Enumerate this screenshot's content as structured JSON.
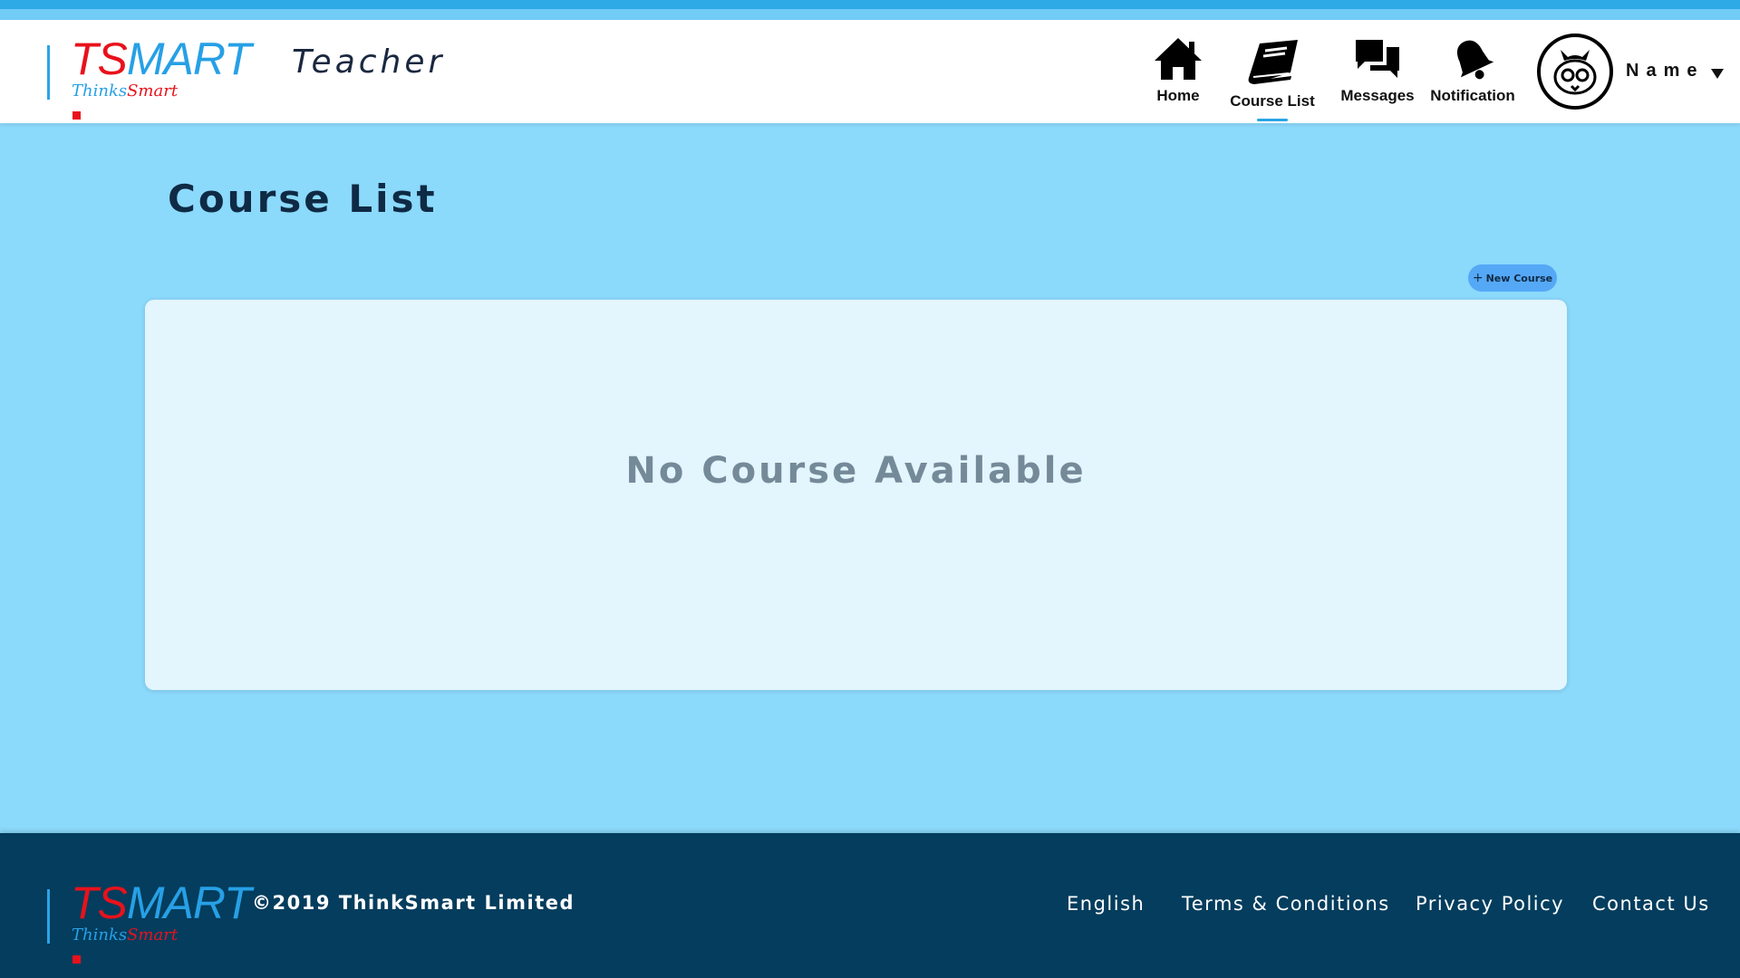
{
  "brand": {
    "wordmark_ts": "TS",
    "wordmark_mart": "MART",
    "tagline_thinks": "Thinks",
    "tagline_smart": "Smart",
    "colors": {
      "red": "#e8121c",
      "blue": "#27a0e6"
    }
  },
  "header": {
    "role": "Teacher",
    "nav": [
      {
        "label": "Home",
        "icon": "home-icon"
      },
      {
        "label": "Course List",
        "icon": "book-icon",
        "active": true
      },
      {
        "label": "Messages",
        "icon": "chat-icon"
      },
      {
        "label": "Notification",
        "icon": "bell-icon"
      }
    ],
    "user": {
      "name": "Name",
      "avatar_icon": "owl-avatar-icon"
    }
  },
  "main": {
    "title": "Course List",
    "new_course_label": "New Course",
    "empty_message": "No Course Available"
  },
  "footer": {
    "copyright": "©2019 ThinkSmart Limited",
    "links": [
      "English",
      "Terms & Conditions",
      "Privacy Policy",
      "Contact Us"
    ]
  },
  "theme": {
    "page_bg": "#8bd9fb",
    "header_bg": "#ffffff",
    "footer_bg": "#043d5d",
    "accent": "#2aa4e5",
    "button_bg": "#55a8f6"
  }
}
